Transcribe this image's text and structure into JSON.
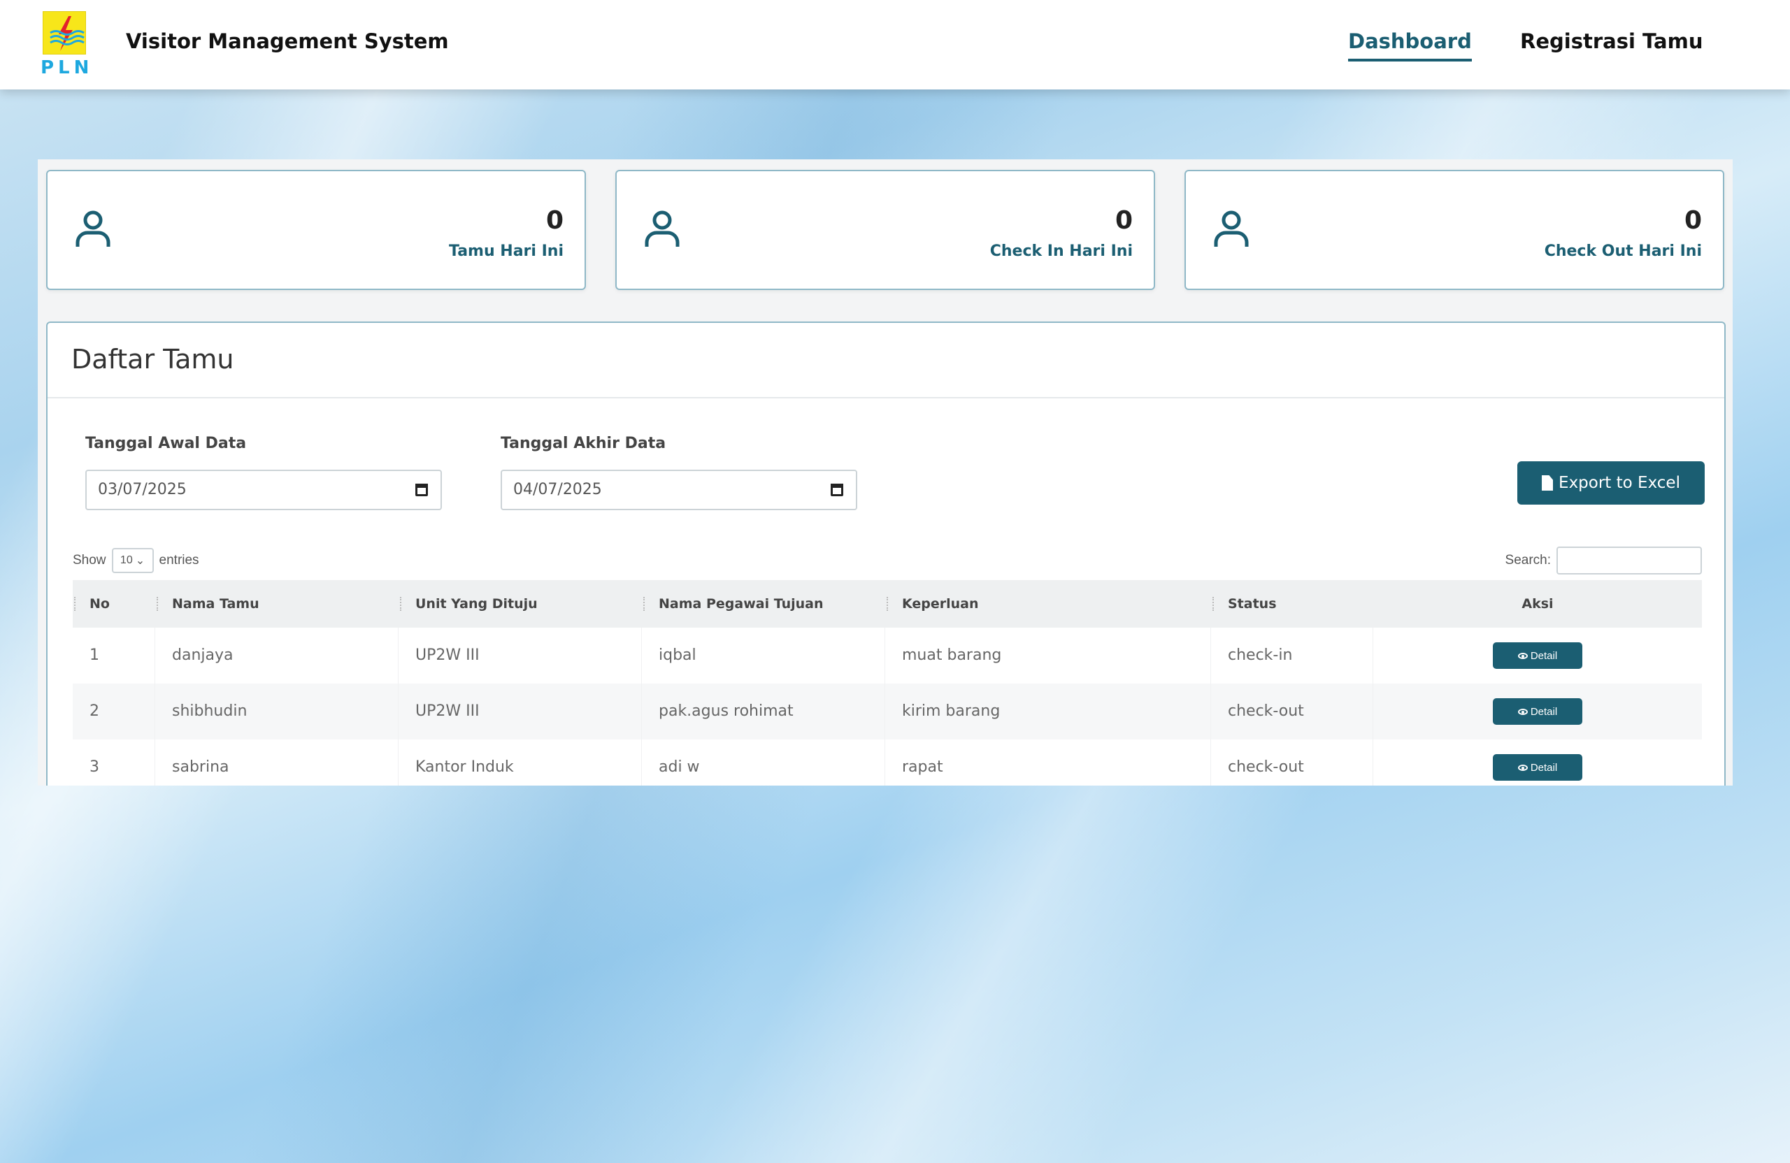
{
  "header": {
    "logo_text": "PLN",
    "app_title": "Visitor Management System",
    "nav": {
      "dashboard": "Dashboard",
      "registrasi": "Registrasi Tamu"
    }
  },
  "stats": [
    {
      "value": "0",
      "label": "Tamu Hari Ini",
      "icon": "user-icon"
    },
    {
      "value": "0",
      "label": "Check In Hari Ini",
      "icon": "user-icon"
    },
    {
      "value": "0",
      "label": "Check Out Hari Ini",
      "icon": "user-icon"
    }
  ],
  "list": {
    "title": "Daftar Tamu",
    "start_date_label": "Tanggal Awal Data",
    "start_date_value": "03/07/2025",
    "end_date_label": "Tanggal Akhir Data",
    "end_date_value": "04/07/2025",
    "export_label": "Export to Excel",
    "show_label": "Show",
    "entries_value": "10",
    "entries_label": "entries",
    "search_label": "Search:",
    "columns": [
      "No",
      "Nama Tamu",
      "Unit Yang Dituju",
      "Nama Pegawai Tujuan",
      "Keperluan",
      "Status",
      "Aksi"
    ],
    "rows": [
      {
        "no": "1",
        "nama": "danjaya",
        "unit": "UP2W III",
        "pegawai": "iqbal",
        "keperluan": "muat barang",
        "status": "check-in",
        "aksi": "Detail"
      },
      {
        "no": "2",
        "nama": "shibhudin",
        "unit": "UP2W III",
        "pegawai": "pak.agus rohimat",
        "keperluan": "kirim barang",
        "status": "check-out",
        "aksi": "Detail"
      },
      {
        "no": "3",
        "nama": "sabrina",
        "unit": "Kantor Induk",
        "pegawai": "adi w",
        "keperluan": "rapat",
        "status": "check-out",
        "aksi": "Detail"
      }
    ]
  },
  "colors": {
    "primary": "#1b5e72",
    "logo_yellow": "#f7e61a",
    "logo_blue": "#1ea8df"
  }
}
